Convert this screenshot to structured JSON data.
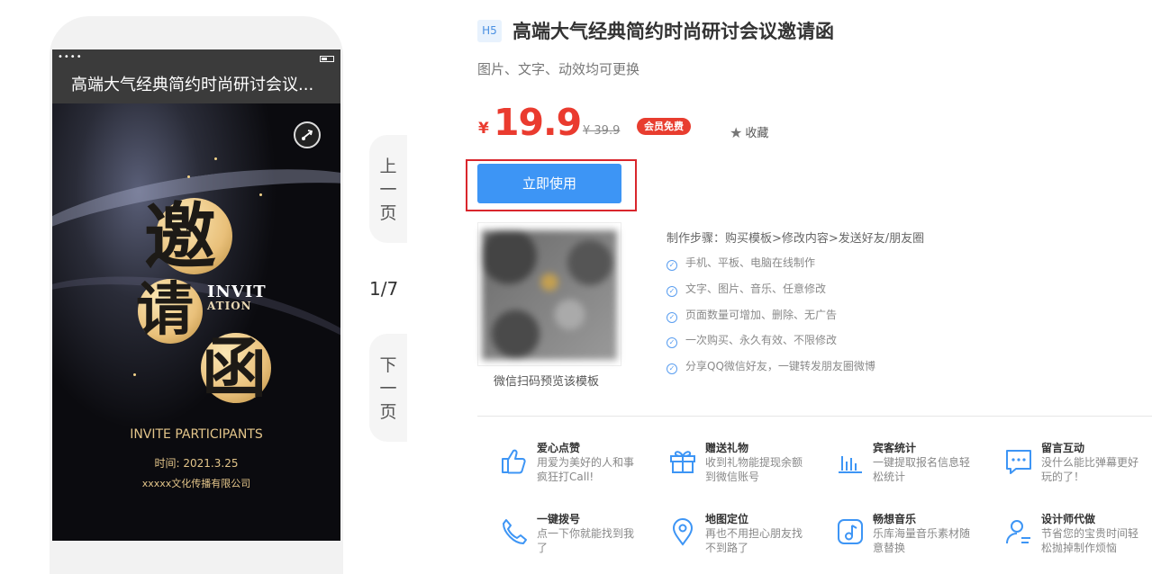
{
  "preview": {
    "status_dots": "••••",
    "title": "高端大气经典简约时尚研讨会议...",
    "poster": {
      "big_chars": [
        "邀",
        "请",
        "函"
      ],
      "invite_line1": "INVIT",
      "invite_line2": "ATION",
      "participants": "INVITE PARTICIPANTS",
      "time": "时间: 2021.3.25",
      "company": "xxxxx文化传播有限公司"
    }
  },
  "pager": {
    "prev_chars": [
      "上",
      "一",
      "页"
    ],
    "next_chars": [
      "下",
      "一",
      "页"
    ],
    "counter": "1/7"
  },
  "product": {
    "badge": "H5",
    "title": "高端大气经典简约时尚研讨会议邀请函",
    "subtitle": "图片、文字、动效均可更换",
    "currency": "¥",
    "price": "19.9",
    "old_price": "¥ 39.9",
    "member_badge": "会员免费",
    "favorite_label": "收藏",
    "use_button": "立即使用",
    "qr_label": "微信扫码预览该模板"
  },
  "steps": {
    "title": "制作步骤：购买模板>修改内容>发送好友/朋友圈",
    "items": [
      "手机、平板、电脑在线制作",
      "文字、图片、音乐、任意修改",
      "页面数量可增加、删除、无广告",
      "一次购买、永久有效、不限修改",
      "分享QQ微信好友，一键转发朋友圈微博"
    ]
  },
  "features": [
    {
      "name": "爱心点赞",
      "desc": "用爱为美好的人和事疯狂打Call!",
      "icon": "thumbs-up-icon"
    },
    {
      "name": "赠送礼物",
      "desc": "收到礼物能提现余额到微信账号",
      "icon": "gift-icon"
    },
    {
      "name": "宾客统计",
      "desc": "一键提取报名信息轻松统计",
      "icon": "bar-chart-icon"
    },
    {
      "name": "留言互动",
      "desc": "没什么能比弹幕更好玩的了！",
      "icon": "message-icon"
    },
    {
      "name": "一键拨号",
      "desc": "点一下你就能找到我了",
      "icon": "phone-icon"
    },
    {
      "name": "地图定位",
      "desc": "再也不用担心朋友找不到路了",
      "icon": "location-pin-icon"
    },
    {
      "name": "畅想音乐",
      "desc": "乐库海量音乐素材随意替换",
      "icon": "music-note-icon"
    },
    {
      "name": "设计师代做",
      "desc": "节省您的宝贵时间轻松抛掉制作烦恼",
      "icon": "designer-icon"
    }
  ],
  "colors": {
    "price_red": "#ea3b2f",
    "primary_blue": "#3d95f5",
    "highlight_frame": "#d9262c",
    "poster_gold": "#e3c58a"
  }
}
